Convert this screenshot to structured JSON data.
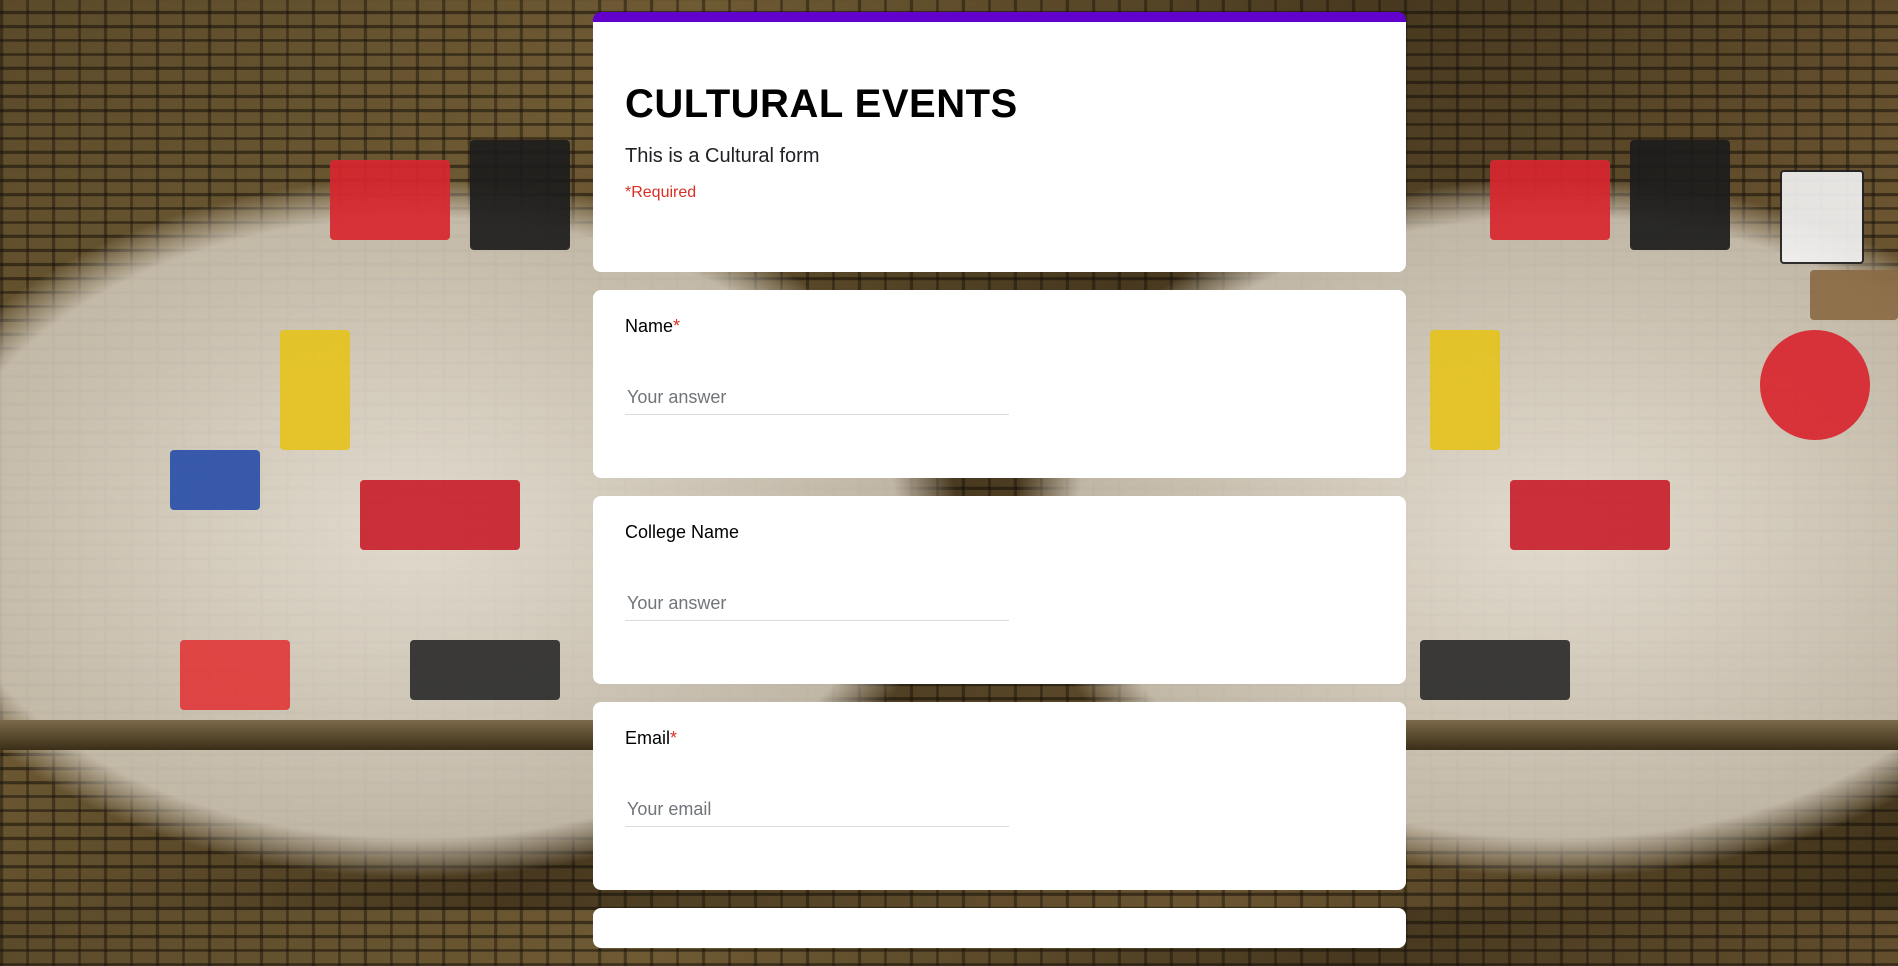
{
  "form": {
    "accent_color": "#6200cc",
    "title": "CULTURAL EVENTS",
    "description": "This is a Cultural form",
    "required_note": "*Required"
  },
  "questions": [
    {
      "label": "Name",
      "required": true,
      "placeholder": "Your answer",
      "value": ""
    },
    {
      "label": "College Name",
      "required": false,
      "placeholder": "Your answer",
      "value": ""
    },
    {
      "label": "Email",
      "required": true,
      "placeholder": "Your email",
      "value": ""
    }
  ],
  "required_marker": "*"
}
